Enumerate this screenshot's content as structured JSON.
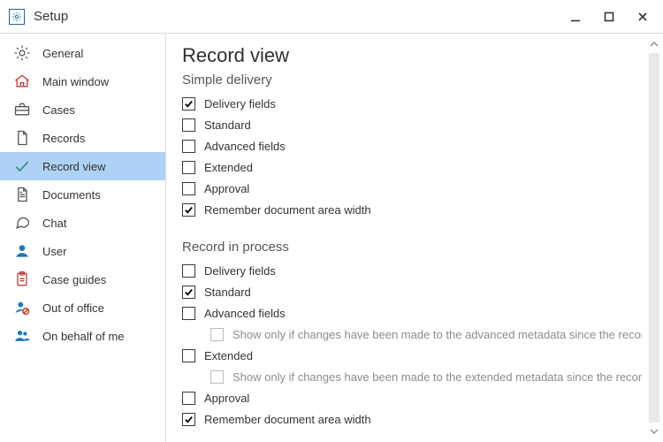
{
  "window": {
    "title": "Setup"
  },
  "sidebar": {
    "items": [
      {
        "id": "general",
        "label": "General"
      },
      {
        "id": "main-window",
        "label": "Main window"
      },
      {
        "id": "cases",
        "label": "Cases"
      },
      {
        "id": "records",
        "label": "Records"
      },
      {
        "id": "record-view",
        "label": "Record view",
        "selected": true
      },
      {
        "id": "documents",
        "label": "Documents"
      },
      {
        "id": "chat",
        "label": "Chat"
      },
      {
        "id": "user",
        "label": "User"
      },
      {
        "id": "case-guides",
        "label": "Case guides"
      },
      {
        "id": "out-of-office",
        "label": "Out of office"
      },
      {
        "id": "on-behalf-of-me",
        "label": "On behalf of me"
      }
    ]
  },
  "page": {
    "title": "Record view",
    "sections": {
      "simple_delivery": {
        "heading": "Simple delivery",
        "options": {
          "delivery_fields": {
            "label": "Delivery fields",
            "checked": true
          },
          "standard": {
            "label": "Standard",
            "checked": false
          },
          "advanced_fields": {
            "label": "Advanced fields",
            "checked": false
          },
          "extended": {
            "label": "Extended",
            "checked": false
          },
          "approval": {
            "label": "Approval",
            "checked": false
          },
          "remember_width": {
            "label": "Remember document area width",
            "checked": true
          }
        }
      },
      "record_in_process": {
        "heading": "Record in process",
        "options": {
          "delivery_fields": {
            "label": "Delivery fields",
            "checked": false
          },
          "standard": {
            "label": "Standard",
            "checked": true
          },
          "advanced_fields": {
            "label": "Advanced fields",
            "checked": false,
            "sub": {
              "label": "Show only if changes have been made to the advanced metadata since the record was created",
              "checked": false,
              "disabled": true
            }
          },
          "extended": {
            "label": "Extended",
            "checked": false,
            "sub": {
              "label": "Show only if changes have been made to the extended metadata since the record was created",
              "checked": false,
              "disabled": true
            }
          },
          "approval": {
            "label": "Approval",
            "checked": false
          },
          "remember_width": {
            "label": "Remember document area width",
            "checked": true
          }
        }
      }
    }
  }
}
